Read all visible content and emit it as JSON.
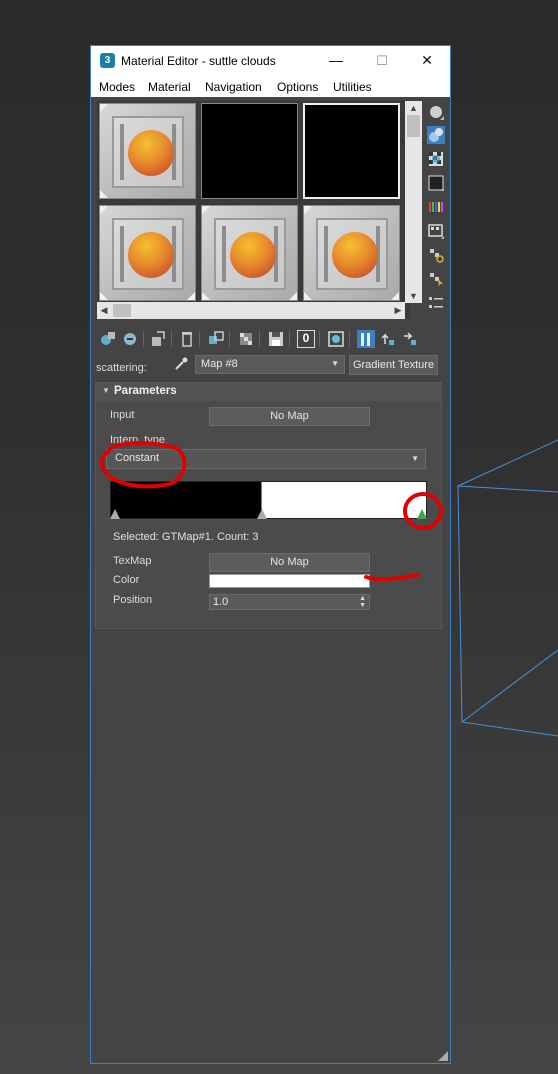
{
  "window": {
    "title": "Material Editor - suttle clouds",
    "app_icon_glyph": "3",
    "minimize_glyph": "—",
    "maximize_glyph": "☐",
    "close_glyph": "✕"
  },
  "menu": [
    "Modes",
    "Material",
    "Navigation",
    "Options",
    "Utilities"
  ],
  "slots": [
    {
      "kind": "material",
      "selected": false
    },
    {
      "kind": "empty",
      "selected": false
    },
    {
      "kind": "empty",
      "selected": true
    },
    {
      "kind": "material",
      "selected": false
    },
    {
      "kind": "material",
      "selected": false
    },
    {
      "kind": "material",
      "selected": false
    }
  ],
  "side_toolbar_icons": [
    "sample-type-sphere-icon",
    "backlight-icon",
    "background-checker-icon",
    "sample-uv-tiling-icon",
    "video-color-check-icon",
    "make-preview-icon",
    "options-icon",
    "select-by-material-icon",
    "material-map-navigator-icon"
  ],
  "bottom_toolbar_icons": [
    "get-material-icon",
    "put-to-scene-icon",
    "assign-to-selection-icon",
    "reset-map-icon",
    "make-copy-icon",
    "make-unique-icon",
    "put-to-library-icon",
    "material-id-channel-icon",
    "show-shaded-map-icon",
    "show-end-result-icon",
    "go-to-parent-icon",
    "go-forward-sibling-icon"
  ],
  "material_id_channel": "0",
  "map_row": {
    "label": "scattering:",
    "map_name": "Map #8",
    "type_button": "Gradient Texture"
  },
  "parameters": {
    "title": "Parameters",
    "input_label": "Input",
    "input_button": "No Map",
    "interp_label": "Interp. type",
    "interp_value": "Constant",
    "gradient_stops": [
      0.0,
      0.478,
      1.0
    ],
    "status": "Selected: GTMap#1. Count: 3",
    "texmap_label": "TexMap",
    "texmap_button": "No Map",
    "color_label": "Color",
    "color_value": "#ffffff",
    "position_label": "Position",
    "position_value": "1.0"
  },
  "colors": {
    "annotation": "#e00000",
    "wireframe": "#4a90d9",
    "window_border": "#3d7fc4"
  }
}
